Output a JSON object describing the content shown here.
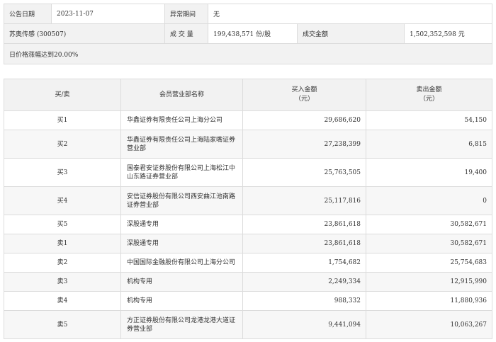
{
  "summary": {
    "date_label": "公告日期",
    "date_value": "2023-11-07",
    "period_label": "异常期间",
    "period_value": "无",
    "stock_name": "苏奥传感 (300507)",
    "volume_label": "成 交 量",
    "volume_value": "199,438,571 份/股",
    "amount_label": "成交金额",
    "amount_value": "1,502,352,598 元",
    "reason": "日价格涨幅达到20.00%"
  },
  "table": {
    "headers": {
      "side": "买/卖",
      "broker": "会员营业部名称",
      "buy_line1": "买入金额",
      "buy_line2": "（元）",
      "sell_line1": "卖出金额",
      "sell_line2": "（元）"
    },
    "rows": [
      {
        "side": "买1",
        "broker": "华鑫证券有限责任公司上海分公司",
        "buy": "29,686,620",
        "sell": "54,150"
      },
      {
        "side": "买2",
        "broker": "华鑫证券有限责任公司上海陆家嘴证券营业部",
        "buy": "27,238,399",
        "sell": "6,815"
      },
      {
        "side": "买3",
        "broker": "国泰君安证券股份有限公司上海松江中山东路证券营业部",
        "buy": "25,763,505",
        "sell": "19,400"
      },
      {
        "side": "买4",
        "broker": "安信证券股份有限公司西安曲江池南路证券营业部",
        "buy": "25,117,816",
        "sell": "0"
      },
      {
        "side": "买5",
        "broker": "深股通专用",
        "buy": "23,861,618",
        "sell": "30,582,671"
      },
      {
        "side": "卖1",
        "broker": "深股通专用",
        "buy": "23,861,618",
        "sell": "30,582,671"
      },
      {
        "side": "卖2",
        "broker": "中国国际金融股份有限公司上海分公司",
        "buy": "1,754,682",
        "sell": "25,754,683"
      },
      {
        "side": "卖3",
        "broker": "机构专用",
        "buy": "2,249,334",
        "sell": "12,915,990"
      },
      {
        "side": "卖4",
        "broker": "机构专用",
        "buy": "988,332",
        "sell": "11,880,936"
      },
      {
        "side": "卖5",
        "broker": "方正证券股份有限公司龙港龙港大道证券营业部",
        "buy": "9,441,094",
        "sell": "10,063,267"
      }
    ]
  }
}
